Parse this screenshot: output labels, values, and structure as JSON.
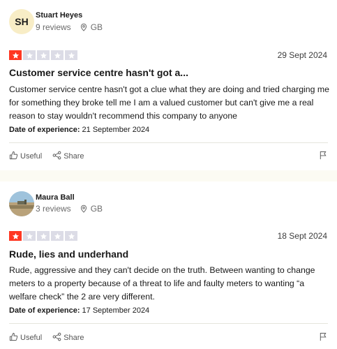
{
  "reviews": [
    {
      "initials": "SH",
      "name": "Stuart Heyes",
      "review_count": "9 reviews",
      "country": "GB",
      "rating": 1,
      "rating_max": 5,
      "date": "29 Sept 2024",
      "title": "Customer service centre hasn't got a...",
      "body": "Customer service centre hasn't got a clue what they are doing and tried charging me for something they broke tell me I am a valued customer but can't give me a real reason to stay wouldn't recommend this company to anyone",
      "experience_label": "Date of experience:",
      "experience_date": "21 September 2024",
      "useful_label": "Useful",
      "share_label": "Share"
    },
    {
      "name": "Maura Ball",
      "review_count": "3 reviews",
      "country": "GB",
      "rating": 1,
      "rating_max": 5,
      "date": "18 Sept 2024",
      "title": "Rude, lies and underhand",
      "body": "Rude, aggressive and they can't decide on the truth. Between wanting to change meters to a property because of a threat to life and faulty meters to wanting “a welfare check” the 2 are very different.",
      "experience_label": "Date of experience:",
      "experience_date": "17 September 2024",
      "useful_label": "Useful",
      "share_label": "Share"
    }
  ],
  "colors": {
    "star_filled": "#ff3722",
    "star_empty": "#dcdce6",
    "avatar_bg": "#f8edc6",
    "separator": "#fcfbf3"
  },
  "icons": {
    "location": "map-pin-icon",
    "useful": "thumbs-up-icon",
    "share": "share-icon",
    "flag": "flag-icon",
    "star": "star-icon"
  }
}
